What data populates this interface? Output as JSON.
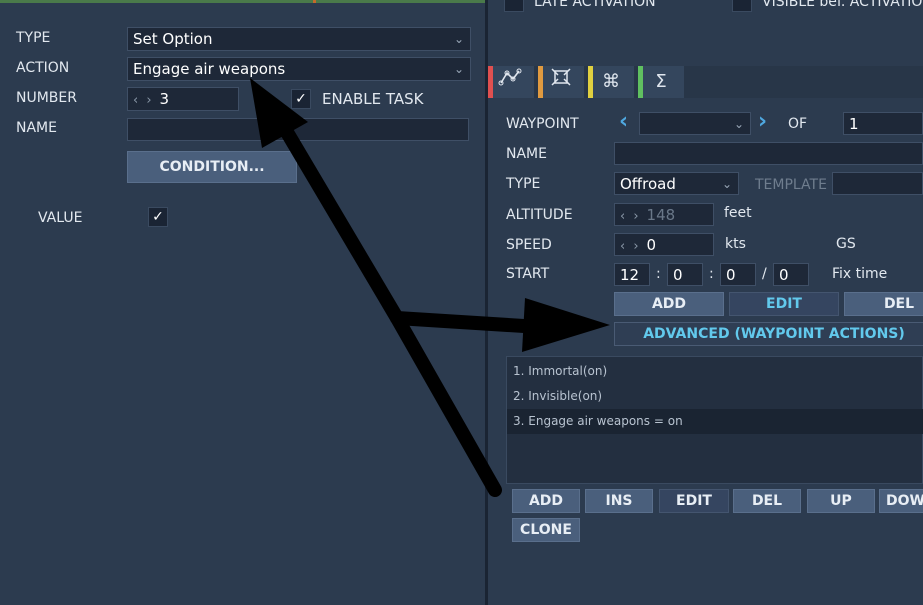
{
  "left": {
    "type_label": "TYPE",
    "type_value": "Set Option",
    "action_label": "ACTION",
    "action_value": "Engage air weapons",
    "number_label": "NUMBER",
    "number_value": "3",
    "enable_task_label": "ENABLE TASK",
    "name_label": "NAME",
    "condition_button": "CONDITION...",
    "value_label": "VALUE"
  },
  "right": {
    "late_activation": "LATE ACTIVATION",
    "visible_activation": "VISIBLE bef. ACTIVATION",
    "tabs": [
      {
        "icon": "⛰",
        "color": "#e05050"
      },
      {
        "icon": "⌖",
        "color": "#e09a40"
      },
      {
        "icon": "⌘",
        "color": "#e0d040"
      },
      {
        "icon": "Σ",
        "color": "#60c060"
      }
    ],
    "waypoint_label": "WAYPOINT",
    "of_label": "OF",
    "of_value": "1",
    "name_label": "NAME",
    "type_label": "TYPE",
    "type_value": "Offroad",
    "template_label": "TEMPLATE",
    "altitude_label": "ALTITUDE",
    "altitude_value": "148",
    "altitude_unit": "feet",
    "speed_label": "SPEED",
    "speed_value": "0",
    "speed_unit": "kts",
    "gs_label": "GS",
    "start_label": "START",
    "start_h": "12",
    "start_m": "0",
    "start_s": "0",
    "start_d": "0",
    "fix_time": "Fix time",
    "add_button": "ADD",
    "edit_button": "EDIT",
    "del_button": "DEL",
    "advanced_button": "ADVANCED (WAYPOINT ACTIONS)",
    "actions": [
      "1. Immortal(on)",
      "2. Invisible(on)",
      "3. Engage air weapons = on"
    ],
    "bottom_buttons": [
      "ADD",
      "INS",
      "EDIT",
      "DEL",
      "UP",
      "DOWN"
    ],
    "clone_button": "CLONE"
  }
}
